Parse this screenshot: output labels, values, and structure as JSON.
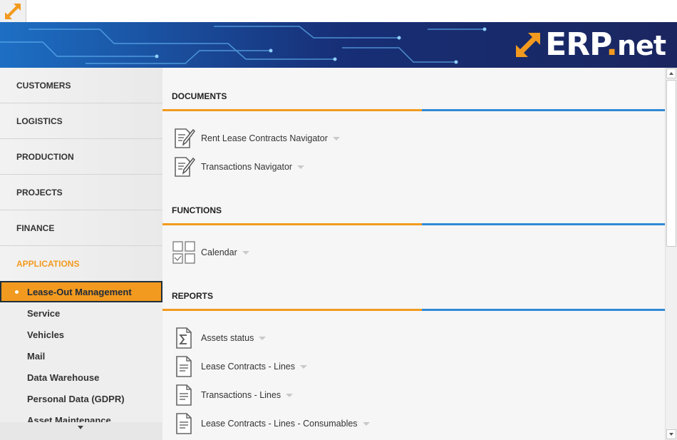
{
  "app": {
    "menu_icon": "expand-arrows-icon",
    "brand": {
      "part1": "ERP",
      "dot": ".",
      "part2": "net",
      "mark_icon": "erp-logo-arrows-icon",
      "accent": "#f29a1f"
    }
  },
  "sidebar": {
    "categories": [
      {
        "label": "CUSTOMERS"
      },
      {
        "label": "LOGISTICS"
      },
      {
        "label": "PRODUCTION"
      },
      {
        "label": "PROJECTS"
      },
      {
        "label": "FINANCE"
      },
      {
        "label": "APPLICATIONS",
        "active": true
      }
    ],
    "applications": [
      {
        "label": "Lease-Out Management",
        "selected": true
      },
      {
        "label": "Service"
      },
      {
        "label": "Vehicles"
      },
      {
        "label": "Mail"
      },
      {
        "label": "Data Warehouse"
      },
      {
        "label": "Personal Data (GDPR)"
      },
      {
        "label": "Asset Maintenance"
      }
    ],
    "scroll_icon": "chevron-down-icon"
  },
  "main": {
    "documents": {
      "title": "DOCUMENTS",
      "items": [
        {
          "label": "Rent Lease Contracts Navigator",
          "icon": "document-edit-icon"
        },
        {
          "label": "Transactions Navigator",
          "icon": "document-edit-icon"
        }
      ]
    },
    "functions": {
      "title": "FUNCTIONS",
      "items": [
        {
          "label": "Calendar",
          "icon": "calendar-grid-icon"
        }
      ]
    },
    "reports": {
      "title": "REPORTS",
      "items": [
        {
          "label": "Assets status",
          "icon": "sum-report-icon"
        },
        {
          "label": "Lease Contracts - Lines",
          "icon": "report-document-icon"
        },
        {
          "label": "Transactions - Lines",
          "icon": "report-document-icon"
        },
        {
          "label": "Lease Contracts - Lines - Consumables",
          "icon": "report-document-icon"
        }
      ]
    }
  },
  "colors": {
    "orange": "#f29a1f",
    "blue": "#2f8ad6",
    "navy": "#1e2f3c"
  }
}
